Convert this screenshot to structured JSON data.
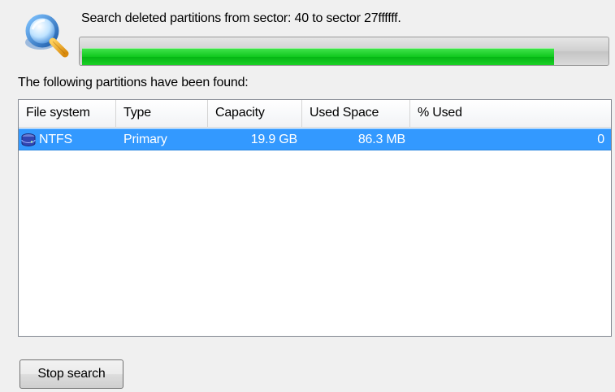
{
  "status": {
    "text": "Search deleted partitions from sector: 40 to sector 27ffffff.",
    "progress_fraction": 0.9
  },
  "found_label": "The following partitions have been found:",
  "table": {
    "columns": [
      "File system",
      "Type",
      "Capacity",
      "Used Space",
      "% Used"
    ],
    "rows": [
      {
        "file_system": "NTFS",
        "type": "Primary",
        "capacity": "19.9 GB",
        "used_space": "86.3 MB",
        "percent_used": "0",
        "selected": true,
        "icon": "partition-drive-icon"
      }
    ]
  },
  "buttons": {
    "stop_search": "Stop search"
  },
  "icons": {
    "header": "search-magnifier-icon"
  },
  "colors": {
    "progress": "#10c81e",
    "selection": "#3399ff",
    "window_bg": "#f0f0f0"
  }
}
